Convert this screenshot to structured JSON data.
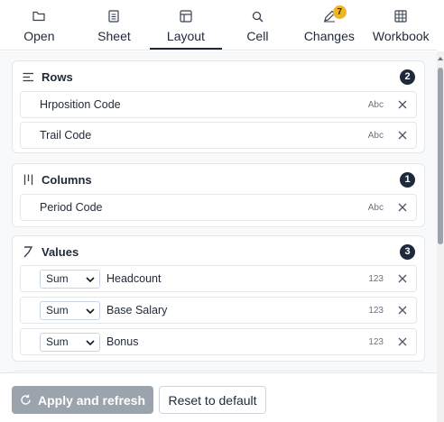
{
  "tabs": [
    {
      "label": "Open",
      "icon": "folder-icon"
    },
    {
      "label": "Sheet",
      "icon": "sheet-icon"
    },
    {
      "label": "Layout",
      "icon": "layout-icon",
      "active": true
    },
    {
      "label": "Cell",
      "icon": "search-icon"
    },
    {
      "label": "Changes",
      "icon": "pen-icon",
      "badge": "7"
    },
    {
      "label": "Workbook",
      "icon": "grid-icon"
    }
  ],
  "rows_panel": {
    "title": "Rows",
    "count": "2",
    "items": [
      {
        "name": "Hrposition Code",
        "type": "Abc"
      },
      {
        "name": "Trail Code",
        "type": "Abc"
      }
    ]
  },
  "columns_panel": {
    "title": "Columns",
    "count": "1",
    "items": [
      {
        "name": "Period Code",
        "type": "Abc"
      }
    ]
  },
  "values_panel": {
    "title": "Values",
    "count": "3",
    "items": [
      {
        "agg": "Sum",
        "name": "Headcount",
        "type": "123"
      },
      {
        "agg": "Sum",
        "name": "Base Salary",
        "type": "123"
      },
      {
        "agg": "Sum",
        "name": "Bonus",
        "type": "123"
      }
    ]
  },
  "footer": {
    "apply_label": "Apply and refresh",
    "reset_label": "Reset to default"
  },
  "colors": {
    "accent": "#1e293b",
    "badge": "#f0b429",
    "apply_disabled": "#9ba3ac"
  }
}
